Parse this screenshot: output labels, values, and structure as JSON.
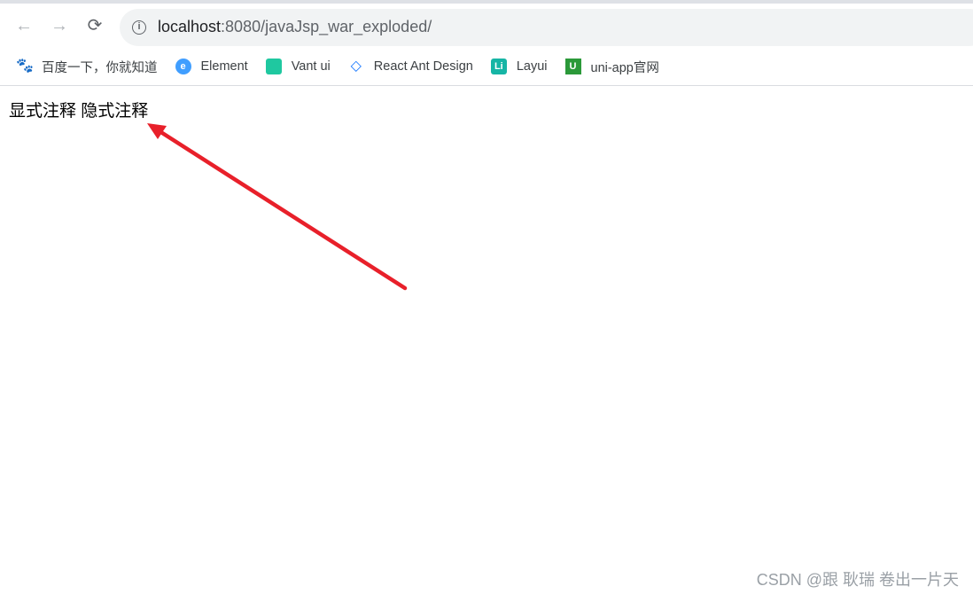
{
  "browser": {
    "url_host": "localhost",
    "url_rest": ":8080/javaJsp_war_exploded/",
    "bookmarks": [
      {
        "label": "百度一下，你就知道",
        "icon": "baidu-paw-icon",
        "color": "#2932e1"
      },
      {
        "label": "Element",
        "icon": "element-icon",
        "color": "#409eff"
      },
      {
        "label": "Vant ui",
        "icon": "vant-icon",
        "color": "#1fc8a0"
      },
      {
        "label": "React Ant Design",
        "icon": "ant-design-icon",
        "color": "#1677ff"
      },
      {
        "label": "Layui",
        "icon": "layui-icon",
        "color": "#16b5a5"
      },
      {
        "label": "uni-app官网",
        "icon": "uni-app-icon",
        "color": "#2b9939"
      }
    ]
  },
  "page": {
    "text": "显式注释 隐式注释"
  },
  "annotation": {
    "arrow_color": "#e8202a"
  },
  "watermark": "CSDN @跟 耿瑞 卷出一片天"
}
